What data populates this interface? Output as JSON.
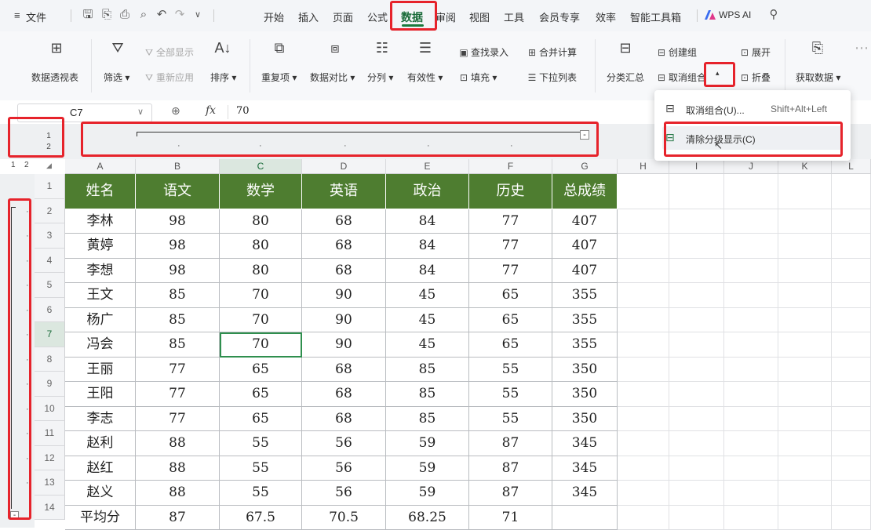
{
  "menubar": {
    "hamburger": "≡",
    "file": "文件",
    "tabs": [
      "开始",
      "插入",
      "页面",
      "公式",
      "数据",
      "审阅",
      "视图",
      "工具",
      "会员专享",
      "效率",
      "智能工具箱"
    ],
    "active_tab": "数据",
    "wps_ai": "WPS AI"
  },
  "ribbon": {
    "pivot": "数据透视表",
    "filter": "筛选",
    "show_all": "全部显示",
    "reapply": "重新应用",
    "sort": "排序",
    "duplicates": "重复项",
    "compare": "数据对比",
    "split": "分列",
    "validity": "有效性",
    "lookup_entry": "查找录入",
    "fill": "填充",
    "consolidate": "合并计算",
    "dropdown_list": "下拉列表",
    "subtotal": "分类汇总",
    "create_group": "创建组",
    "ungroup": "取消组合",
    "expand": "展开",
    "collapse": "折叠",
    "get_data": "获取数据"
  },
  "formula_bar": {
    "cell_ref": "C7",
    "fx": "fx",
    "value": "70"
  },
  "dropdown_menu": {
    "items": [
      {
        "label": "取消组合(U)...",
        "shortcut": "Shift+Alt+Left"
      },
      {
        "label": "清除分级显示(C)",
        "shortcut": ""
      }
    ]
  },
  "outline": {
    "col_levels": [
      "1",
      "2"
    ],
    "row_levels": [
      "1",
      "2"
    ],
    "collapse_button": "-"
  },
  "sheet": {
    "columns": [
      "A",
      "B",
      "C",
      "D",
      "E",
      "F",
      "G",
      "H",
      "I",
      "J",
      "K",
      "L"
    ],
    "active_cell": "C7",
    "headers": [
      "姓名",
      "语文",
      "数学",
      "英语",
      "政治",
      "历史",
      "总成绩"
    ],
    "rows": [
      [
        "李林",
        "98",
        "80",
        "68",
        "84",
        "77",
        "407"
      ],
      [
        "黄婷",
        "98",
        "80",
        "68",
        "84",
        "77",
        "407"
      ],
      [
        "李想",
        "98",
        "80",
        "68",
        "84",
        "77",
        "407"
      ],
      [
        "王文",
        "85",
        "70",
        "90",
        "45",
        "65",
        "355"
      ],
      [
        "杨广",
        "85",
        "70",
        "90",
        "45",
        "65",
        "355"
      ],
      [
        "冯会",
        "85",
        "70",
        "90",
        "45",
        "65",
        "355"
      ],
      [
        "王丽",
        "77",
        "65",
        "68",
        "85",
        "55",
        "350"
      ],
      [
        "王阳",
        "77",
        "65",
        "68",
        "85",
        "55",
        "350"
      ],
      [
        "李志",
        "77",
        "65",
        "68",
        "85",
        "55",
        "350"
      ],
      [
        "赵利",
        "88",
        "55",
        "56",
        "59",
        "87",
        "345"
      ],
      [
        "赵红",
        "88",
        "55",
        "56",
        "59",
        "87",
        "345"
      ],
      [
        "赵义",
        "88",
        "55",
        "56",
        "59",
        "87",
        "345"
      ],
      [
        "平均分",
        "87",
        "67.5",
        "70.5",
        "68.25",
        "71",
        ""
      ]
    ],
    "row_numbers": [
      "1",
      "2",
      "3",
      "4",
      "5",
      "6",
      "7",
      "8",
      "9",
      "10",
      "11",
      "12",
      "13",
      "14"
    ]
  },
  "colors": {
    "header_fill": "#4e7d30",
    "accent_green": "#1a7a3e",
    "highlight_red": "#e6232b"
  }
}
